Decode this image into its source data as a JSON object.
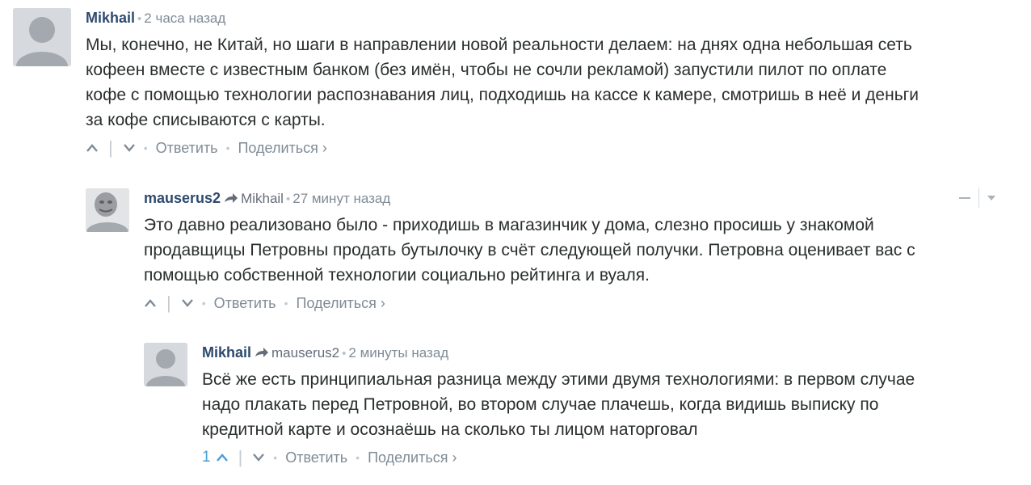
{
  "comments": [
    {
      "author": "Mikhail",
      "reply_to": "",
      "time": "2 часа назад",
      "text": "Мы, конечно, не Китай, но шаги в направлении новой реальности делаем: на днях одна небольшая сеть\nкофеен вместе с известным банком (без имён, чтобы не сочли рекламой) запустили пилот по оплате\nкофе с помощью технологии распознавания лиц, подходишь на кассе к камере, смотришь в неё и деньги\nза кофе списываются с карты.",
      "votes": "",
      "reply_label": "Ответить",
      "share_label": "Поделиться ›"
    },
    {
      "author": "mauserus2",
      "reply_to": "Mikhail",
      "time": "27 минут назад",
      "text": "Это давно реализовано было - приходишь в магазинчик у дома, слезно просишь у знакомой\nпродавщицы Петровны продать бутылочку в счёт следующей получки. Петровна оценивает вас с\nпомощью собственной технологии социально рейтинга и вуаля.",
      "votes": "",
      "reply_label": "Ответить",
      "share_label": "Поделиться ›"
    },
    {
      "author": "Mikhail",
      "reply_to": "mauserus2",
      "time": "2 минуты назад",
      "text": "Всё же есть принципиальная разница между этими двумя технологиями: в первом случае\nнадо плакать перед Петровной, во втором случае плачешь, когда видишь выписку по\nкредитной карте и осознаёшь на сколько ты лицом наторговал",
      "votes": "1",
      "reply_label": "Ответить",
      "share_label": "Поделиться ›"
    }
  ],
  "icons": {
    "upvote": "chevron-up-icon",
    "downvote": "chevron-down-icon",
    "reply_arrow": "reply-arrow-icon",
    "collapse": "minus-icon",
    "menu": "caret-down-icon"
  },
  "colors": {
    "author": "#2e4a6d",
    "meta": "#7f8b96",
    "vote_active": "#4a9ed4",
    "avatar_bg": "#c2c6cc"
  }
}
